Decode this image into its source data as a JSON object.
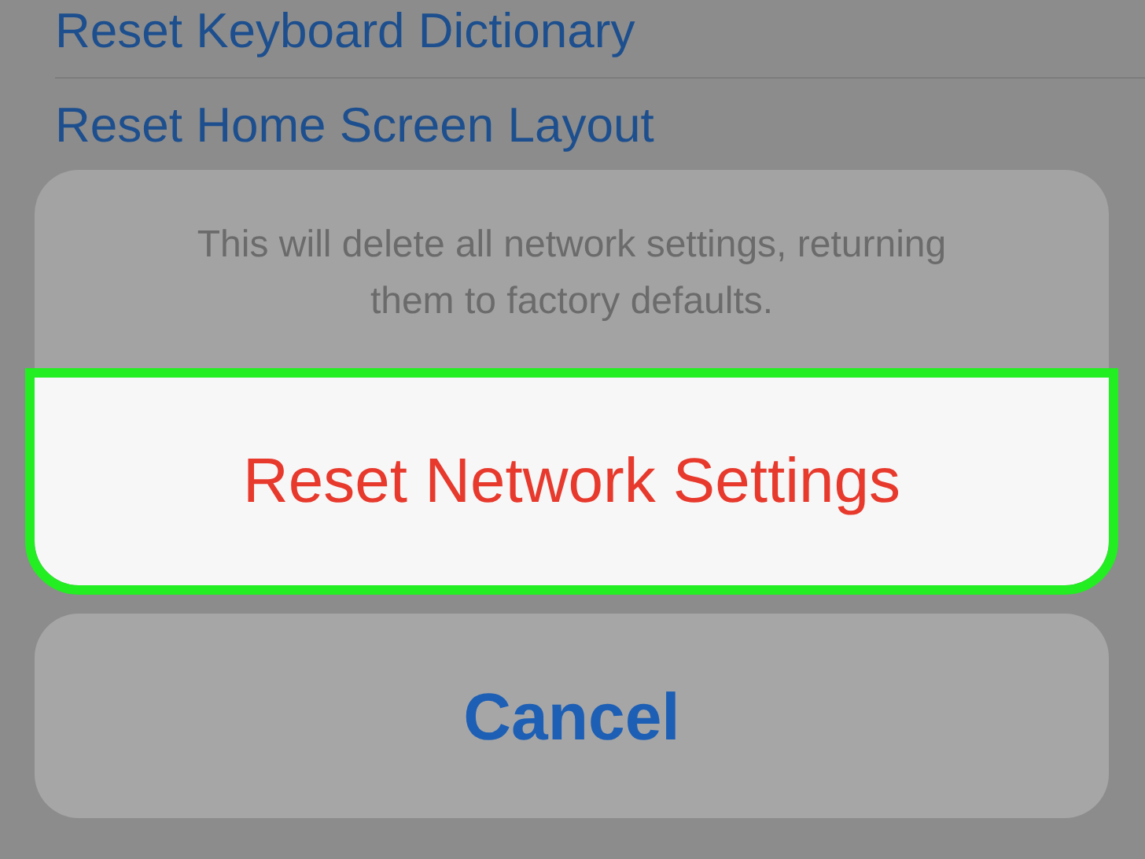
{
  "background_list": [
    {
      "label": "Reset Keyboard Dictionary"
    },
    {
      "label": "Reset Home Screen Layout"
    }
  ],
  "action_sheet": {
    "message": "This will delete all network settings, returning them to factory defaults.",
    "actions": [
      {
        "label": "Reset Network Settings",
        "kind": "destructive",
        "highlighted": true
      }
    ]
  },
  "cancel_button": {
    "label": "Cancel"
  }
}
